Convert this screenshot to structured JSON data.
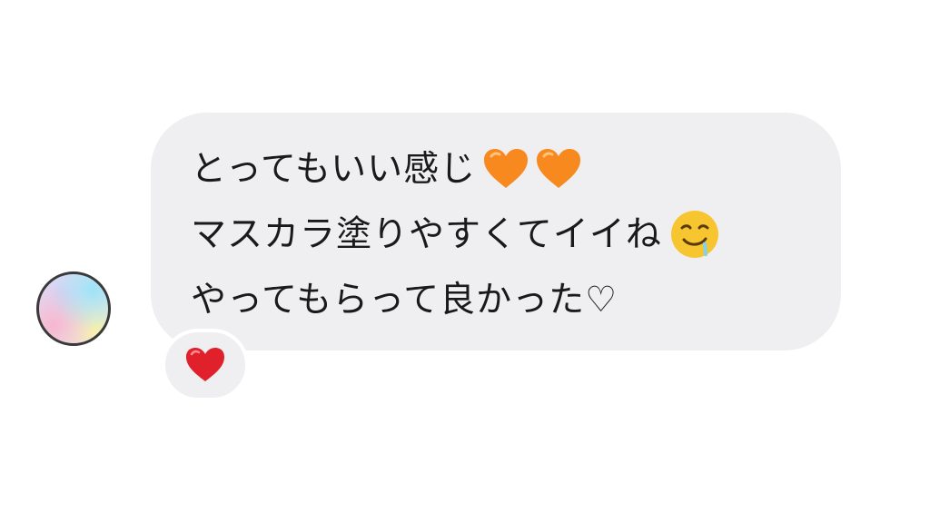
{
  "message": {
    "lines": [
      "とってもいい感じ",
      "マスカラ塗りやすくてイイね",
      "やってもらって良かった♡"
    ],
    "line1_emoji_icons": [
      "orange-heart-icon",
      "orange-heart-icon"
    ],
    "line2_emoji_icon": "drooling-face-icon",
    "bubble_color": "#efeff2",
    "text_color": "#1a1a1a"
  },
  "reaction": {
    "icon": "red-heart-icon",
    "color": "#e0202a"
  },
  "colors": {
    "orange_heart": "#f7891f",
    "face_yellow": "#f7c530"
  }
}
